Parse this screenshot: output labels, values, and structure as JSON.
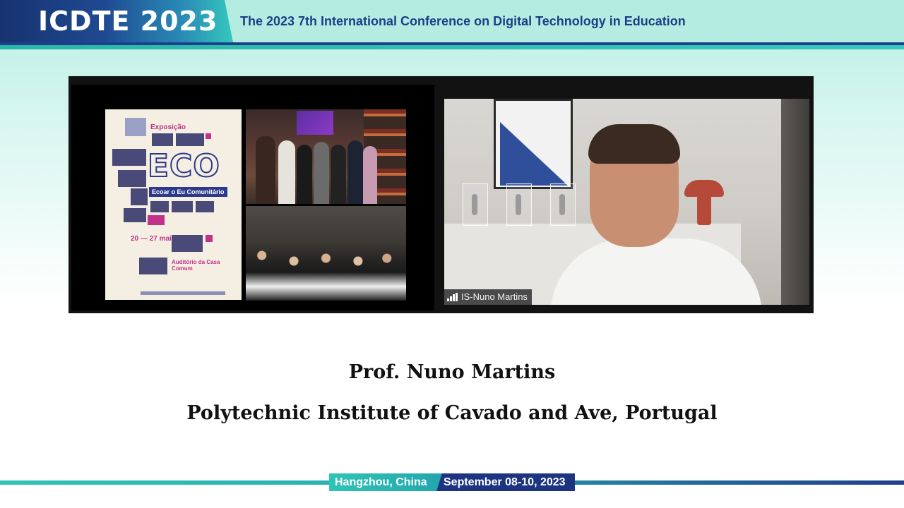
{
  "header": {
    "logo": "ICDTE 2023",
    "title": "The 2023 7th International Conference on Digital Technology in Education",
    "colors": {
      "navy": "#1f3e8c",
      "teal": "#35c9bd"
    }
  },
  "video": {
    "participant_name": "IS-Nuno Martins",
    "poster": {
      "label": "Exposição",
      "title": "ECO",
      "subtitle": "Ecoar o Eu Comunitário",
      "dates": "20 — 27 maio 2023",
      "venue": "Auditório da Casa Comum"
    }
  },
  "caption": {
    "speaker": "Prof. Nuno Martins",
    "affiliation": "Polytechnic Institute of Cavado and Ave, Portugal"
  },
  "footer": {
    "location": "Hangzhou, China",
    "dates": "September 08-10, 2023"
  }
}
